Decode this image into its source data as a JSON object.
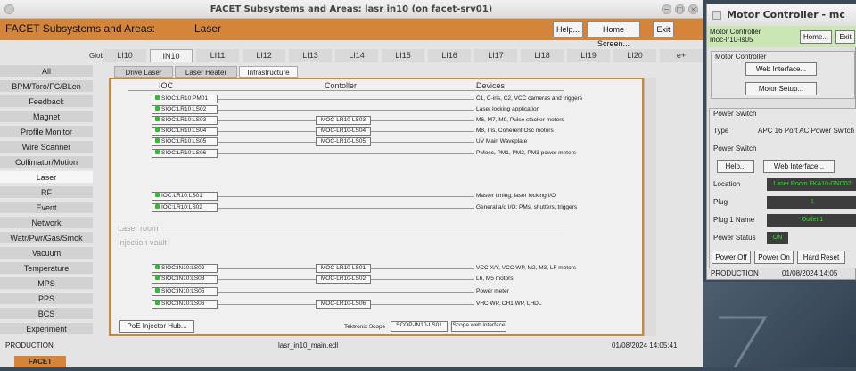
{
  "main_window": {
    "title": "FACET Subsystems and Areas: lasr in10 (on facet-srv01)",
    "header_title": "FACET Subsystems and Areas:",
    "header_area": "Laser",
    "buttons": {
      "help": "Help...",
      "home": "Home Screen...",
      "exit": "Exit"
    }
  },
  "tabs": {
    "global_label": "Global",
    "items": [
      "LI10",
      "IN10",
      "LI11",
      "LI12",
      "LI13",
      "LI14",
      "LI15",
      "LI16",
      "LI17",
      "LI18",
      "LI19",
      "LI20",
      "e+"
    ],
    "active": "IN10"
  },
  "sidebar": {
    "items": [
      "All",
      "BPM/Toro/FC/BLen",
      "Feedback",
      "Magnet",
      "Profile Monitor",
      "Wire Scanner",
      "Collimator/Motion",
      "Laser",
      "RF",
      "Event",
      "Network",
      "Watr/Pwr/Gas/Smok",
      "Vacuum",
      "Temperature",
      "MPS",
      "PPS",
      "BCS",
      "Experiment"
    ],
    "active": "Laser"
  },
  "subtabs": {
    "items": [
      "Drive Laser",
      "Laser Heater",
      "Infrastructure"
    ],
    "active": "Infrastructure"
  },
  "panel": {
    "col_ioc": "IOC",
    "col_controller": "Contoller",
    "col_devices": "Devices",
    "laser_room_rows": [
      {
        "ioc": "SIOC:LR10:PM01",
        "ctrl": "",
        "dev": "C1, C-iris, C2, VCC cameras and triggers"
      },
      {
        "ioc": "SIOC:LR10:LS02",
        "ctrl": "",
        "dev": "Laser locking application"
      },
      {
        "ioc": "SIOC:LR10:LS03",
        "ctrl": "MOC-LR10-LS03",
        "dev": "M6, M7, M9, Pulse stacker motors"
      },
      {
        "ioc": "SIOC:LR10:LS04",
        "ctrl": "MOC-LR10-LS04",
        "dev": "M8, Iris, Coherent Osc motors"
      },
      {
        "ioc": "SIOC:LR10:LS05",
        "ctrl": "MOC-LR10-LS05",
        "dev": "UV Main Waveplate"
      },
      {
        "ioc": "SIOC:LR10:LS06",
        "ctrl": "",
        "dev": "PMosc, PM1, PM2, PM3 power meters"
      },
      {
        "ioc": "IOC:LR10:LS01",
        "ctrl": "",
        "dev": "Master timing, laser locking I/O"
      },
      {
        "ioc": "IOC:LR10:LS02",
        "ctrl": "",
        "dev": "General a/d I/O: PMs, shutters, triggers"
      }
    ],
    "laser_room_label": "Laser room",
    "injection_vault_label": "Injection vault",
    "vault_rows": [
      {
        "ioc": "SIOC:IN10:LS02",
        "ctrl": "MOC-LR10-LS01",
        "dev": "VCC X/Y, VCC WP, M2, M3, LF motors"
      },
      {
        "ioc": "SIOC:IN10:LS03",
        "ctrl": "MOC-LR10-LS02",
        "dev": "L6, M5 motors"
      },
      {
        "ioc": "SIOC:IN10:LS05",
        "ctrl": "",
        "dev": "Power meter"
      },
      {
        "ioc": "SIOC:IN10:LS06",
        "ctrl": "MOC-LR10-LS06",
        "dev": "VHC WP, CH1 WP, LHDL"
      }
    ],
    "poe_button": "PoE Injector Hub...",
    "scope_label": "Tektronix Scope",
    "scope_button": "SCOP-IN10-LS01",
    "scope_web": "Scope web interface"
  },
  "status_bar": {
    "left": "PRODUCTION",
    "center": "lasr_in10_main.edl",
    "right": "01/08/2024 14:05:41"
  },
  "facet_tab": "FACET",
  "motor_window": {
    "title": "Motor Controller - mc",
    "hdr_line1": "Motor Controller",
    "hdr_line2": "moc-lr10-ls05",
    "home": "Home...",
    "exit": "Exit",
    "section1": "Motor Controller",
    "web_interface": "Web Interface...",
    "motor_setup": "Motor Setup...",
    "section2": "Power Switch",
    "type_label": "Type",
    "type_value": "APC 16 Port AC Power Switch",
    "power_switch_label": "Power Switch",
    "help": "Help...",
    "web_interface2": "Web Interface...",
    "location_label": "Location",
    "location_value": "Laser Room FKA10-GND02",
    "plug_label": "Plug",
    "plug_value": "1",
    "plug1name_label": "Plug 1 Name",
    "plug1name_value": "Outlet 1",
    "power_status_label": "Power Status",
    "power_status_value": "ON",
    "power_off": "Power Off",
    "power_on": "Power On",
    "hard_reset": "Hard Reset",
    "status_left": "PRODUCTION",
    "status_right": "01/08/2024 14:05"
  }
}
